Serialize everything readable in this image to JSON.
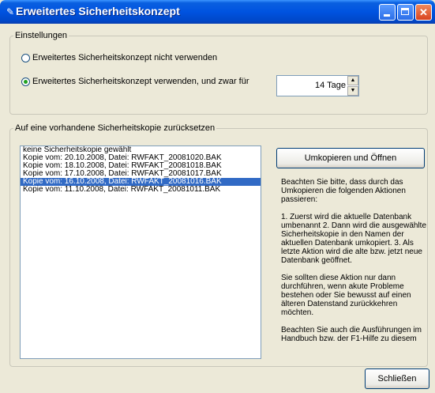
{
  "window": {
    "title": "Erweitertes Sicherheitskonzept"
  },
  "settings": {
    "group_label": "Einstellungen",
    "option_off": "Erweitertes Sicherheitskonzept nicht verwenden",
    "option_on": "Erweitertes Sicherheitskonzept verwenden, und zwar für",
    "selected": "option_on",
    "days_value": "14 Tage"
  },
  "restore": {
    "group_label": "Auf eine vorhandene Sicherheitskopie zurücksetzen",
    "items": [
      "keine Sicherheitskopie gewählt",
      "Kopie vom: 20.10.2008, Datei: RWFAKT_20081020.BAK",
      "Kopie vom: 18.10.2008, Datei: RWFAKT_20081018.BAK",
      "Kopie vom: 17.10.2008, Datei: RWFAKT_20081017.BAK",
      "Kopie vom: 16.10.2008, Datei: RWFAKT_20081016.BAK",
      "Kopie vom: 11.10.2008, Datei: RWFAKT_20081011.BAK"
    ],
    "selected_index": 4,
    "copy_button": "Umkopieren und Öffnen",
    "info": [
      "Beachten Sie bitte, dass durch das Umkopieren die folgenden Aktionen passieren:",
      "1. Zuerst wird die aktuelle Datenbank umbenannt 2. Dann wird die ausgewählte Sicherheitskopie in den Namen der aktuellen Datenbank umkopiert. 3. Als letzte Aktion wird die alte bzw. jetzt neue Datenbank geöffnet.",
      "Sie sollten diese Aktion nur dann durchführen, wenn akute Probleme bestehen oder Sie bewusst auf einen älteren Datenstand zurückkehren möchten.",
      "Beachten Sie auch die Ausführungen im Handbuch bzw. der F1-Hilfe zu diesem"
    ]
  },
  "footer": {
    "close_button": "Schließen"
  }
}
